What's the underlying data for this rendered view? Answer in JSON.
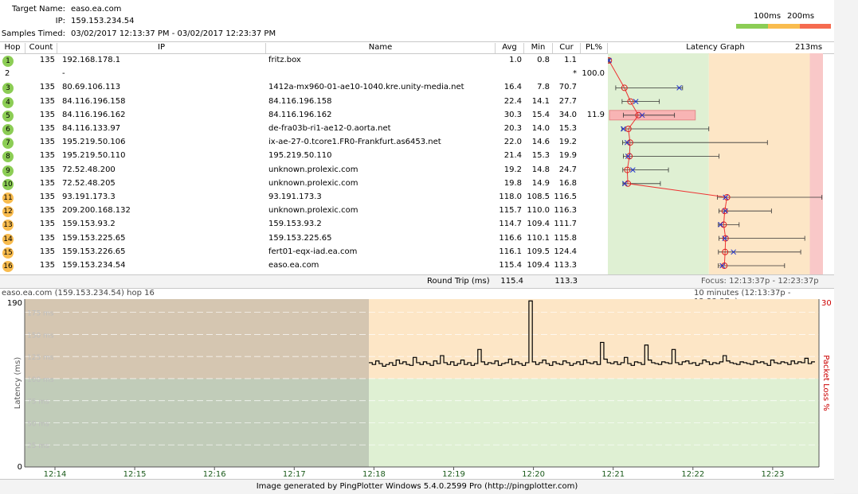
{
  "target": {
    "name_label": "Target Name:",
    "name_value": "easo.ea.com",
    "ip_label": "IP:",
    "ip_value": "159.153.234.54",
    "samples_label": "Samples Timed:",
    "samples_value": "03/02/2017 12:13:37 PM - 03/02/2017 12:23:37 PM"
  },
  "legend": {
    "label_100": "100ms",
    "label_200": "200ms",
    "colors": [
      "#8ccd55",
      "#f9bc4e",
      "#f56b50"
    ]
  },
  "columns": {
    "hop": "Hop",
    "count": "Count",
    "ip": "IP",
    "name": "Name",
    "avg": "Avg",
    "min": "Min",
    "cur": "Cur",
    "pl": "PL%",
    "graph": "Latency Graph",
    "graph_max": "213ms"
  },
  "hops": [
    {
      "hop": "1",
      "count": "135",
      "ip": "192.168.178.1",
      "name": "fritz.box",
      "avg": "1.0",
      "min": "0.8",
      "cur": "1.1",
      "pl": "",
      "status": "green",
      "avg_ms": 1.0,
      "min_ms": 0.8,
      "max_ms": 1.6,
      "cur_ms": 1.1
    },
    {
      "hop": "2",
      "count": "",
      "ip": "-",
      "name": "",
      "avg": "",
      "min": "",
      "cur": "*",
      "pl": "100.0",
      "status": "none"
    },
    {
      "hop": "3",
      "count": "135",
      "ip": "80.69.106.113",
      "name": "1412a-mx960-01-ae10-1040.kre.unity-media.net",
      "avg": "16.4",
      "min": "7.8",
      "cur": "70.7",
      "pl": "",
      "status": "green",
      "avg_ms": 16.4,
      "min_ms": 7.8,
      "max_ms": 74,
      "cur_ms": 70.7
    },
    {
      "hop": "4",
      "count": "135",
      "ip": "84.116.196.158",
      "name": "84.116.196.158",
      "avg": "22.4",
      "min": "14.1",
      "cur": "27.7",
      "pl": "",
      "status": "green",
      "avg_ms": 22.4,
      "min_ms": 14.1,
      "max_ms": 51,
      "cur_ms": 27.7
    },
    {
      "hop": "5",
      "count": "135",
      "ip": "84.116.196.162",
      "name": "84.116.196.162",
      "avg": "30.3",
      "min": "15.4",
      "cur": "34.0",
      "pl": "11.9",
      "status": "green",
      "avg_ms": 30.3,
      "min_ms": 15.4,
      "max_ms": 66,
      "cur_ms": 34.0
    },
    {
      "hop": "6",
      "count": "135",
      "ip": "84.116.133.97",
      "name": "de-fra03b-ri1-ae12-0.aorta.net",
      "avg": "20.3",
      "min": "14.0",
      "cur": "15.3",
      "pl": "",
      "status": "green",
      "avg_ms": 20.3,
      "min_ms": 14.0,
      "max_ms": 100,
      "cur_ms": 15.3
    },
    {
      "hop": "7",
      "count": "135",
      "ip": "195.219.50.106",
      "name": "ix-ae-27-0.tcore1.FR0-Frankfurt.as6453.net",
      "avg": "22.0",
      "min": "14.6",
      "cur": "19.2",
      "pl": "",
      "status": "green",
      "avg_ms": 22.0,
      "min_ms": 14.6,
      "max_ms": 158,
      "cur_ms": 19.2
    },
    {
      "hop": "8",
      "count": "135",
      "ip": "195.219.50.110",
      "name": "195.219.50.110",
      "avg": "21.4",
      "min": "15.3",
      "cur": "19.9",
      "pl": "",
      "status": "green",
      "avg_ms": 21.4,
      "min_ms": 15.3,
      "max_ms": 110,
      "cur_ms": 19.9
    },
    {
      "hop": "9",
      "count": "135",
      "ip": "72.52.48.200",
      "name": "unknown.prolexic.com",
      "avg": "19.2",
      "min": "14.8",
      "cur": "24.7",
      "pl": "",
      "status": "green",
      "avg_ms": 19.2,
      "min_ms": 14.8,
      "max_ms": 60,
      "cur_ms": 24.7
    },
    {
      "hop": "10",
      "count": "135",
      "ip": "72.52.48.205",
      "name": "unknown.prolexic.com",
      "avg": "19.8",
      "min": "14.9",
      "cur": "16.8",
      "pl": "",
      "status": "green",
      "avg_ms": 19.8,
      "min_ms": 14.9,
      "max_ms": 52,
      "cur_ms": 16.8
    },
    {
      "hop": "11",
      "count": "135",
      "ip": "93.191.173.3",
      "name": "93.191.173.3",
      "avg": "118.0",
      "min": "108.5",
      "cur": "116.5",
      "pl": "",
      "status": "orange",
      "avg_ms": 118.0,
      "min_ms": 108.5,
      "max_ms": 212,
      "cur_ms": 116.5
    },
    {
      "hop": "12",
      "count": "135",
      "ip": "209.200.168.132",
      "name": "unknown.prolexic.com",
      "avg": "115.7",
      "min": "110.0",
      "cur": "116.3",
      "pl": "",
      "status": "orange",
      "avg_ms": 115.7,
      "min_ms": 110.0,
      "max_ms": 162,
      "cur_ms": 116.3
    },
    {
      "hop": "13",
      "count": "135",
      "ip": "159.153.93.2",
      "name": "159.153.93.2",
      "avg": "114.7",
      "min": "109.4",
      "cur": "111.7",
      "pl": "",
      "status": "orange",
      "avg_ms": 114.7,
      "min_ms": 109.4,
      "max_ms": 130,
      "cur_ms": 111.7
    },
    {
      "hop": "14",
      "count": "135",
      "ip": "159.153.225.65",
      "name": "159.153.225.65",
      "avg": "116.6",
      "min": "110.1",
      "cur": "115.8",
      "pl": "",
      "status": "orange",
      "avg_ms": 116.6,
      "min_ms": 110.1,
      "max_ms": 195,
      "cur_ms": 115.8
    },
    {
      "hop": "15",
      "count": "135",
      "ip": "159.153.226.65",
      "name": "fert01-eqx-iad.ea.com",
      "avg": "116.1",
      "min": "109.5",
      "cur": "124.4",
      "pl": "",
      "status": "orange",
      "avg_ms": 116.1,
      "min_ms": 109.5,
      "max_ms": 191,
      "cur_ms": 124.4
    },
    {
      "hop": "16",
      "count": "135",
      "ip": "159.153.234.54",
      "name": "easo.ea.com",
      "avg": "115.4",
      "min": "109.4",
      "cur": "113.3",
      "pl": "",
      "status": "orange",
      "avg_ms": 115.4,
      "min_ms": 109.4,
      "max_ms": 175,
      "cur_ms": 113.3
    }
  ],
  "round_trip": {
    "label": "Round Trip (ms)",
    "avg": "115.4",
    "cur": "113.3",
    "focus": "Focus: 12:13:37p - 12:23:37p"
  },
  "chart_header": {
    "left": "easo.ea.com (159.153.234.54) hop 16",
    "right": "10 minutes (12:13:37p - 12:23:37p)"
  },
  "chart_data": {
    "type": "line",
    "ylabel": "Latency (ms)",
    "y2label": "Packet Loss %",
    "ylim": [
      0,
      190
    ],
    "y_tick_labels": [
      "190",
      "0"
    ],
    "y2_tick_label": "30",
    "bg_labels": [
      "175 ms",
      "150 ms",
      "125 ms",
      "100 ms",
      "75 ms",
      "50 ms",
      "25 ms"
    ],
    "x_tick_labels": [
      "12:14",
      "12:15",
      "12:16",
      "12:17",
      "12:18",
      "12:19",
      "12:20",
      "12:21",
      "12:22",
      "12:23"
    ],
    "no_data_until": "12:18",
    "series": [
      {
        "values": [
          118,
          116,
          120,
          117,
          114,
          116,
          118,
          115,
          121,
          117,
          119,
          116,
          115,
          124,
          118,
          116,
          119,
          117,
          115,
          120,
          117,
          126,
          118,
          116,
          119,
          115,
          117,
          121,
          116,
          118,
          115,
          117,
          133,
          119,
          116,
          118,
          117,
          120,
          115,
          117,
          118,
          122,
          116,
          119,
          117,
          115,
          118,
          188,
          119,
          116,
          118,
          121,
          117,
          115,
          119,
          117,
          116,
          120,
          118,
          115,
          117,
          119,
          116,
          121,
          118,
          117,
          119,
          116,
          141,
          122,
          118,
          117,
          119,
          116,
          118,
          124,
          117,
          115,
          119,
          118,
          116,
          138,
          121,
          118,
          117,
          116,
          119,
          118,
          117,
          133,
          118,
          116,
          119,
          120,
          117,
          118,
          115,
          117,
          121,
          119,
          116,
          118,
          117,
          119,
          126,
          120,
          118,
          117,
          116,
          119,
          118,
          117,
          116,
          120,
          118,
          119,
          117,
          115,
          121,
          118,
          117,
          119,
          118,
          116,
          120,
          117,
          119,
          118,
          123,
          117,
          119
        ]
      }
    ]
  },
  "footer": "Image generated by PingPlotter Windows 5.4.0.2599 Pro (http://pingplotter.com)"
}
